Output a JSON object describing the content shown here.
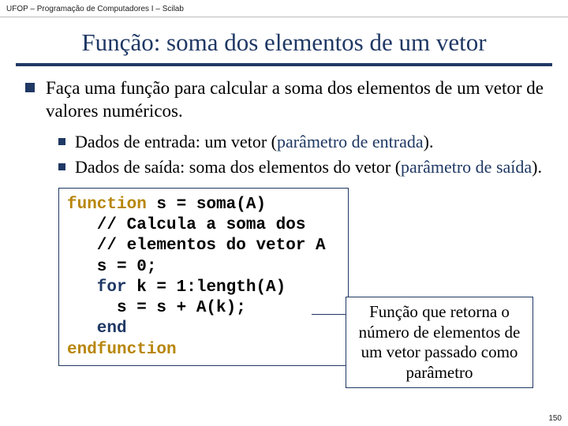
{
  "header": "UFOP – Programação de Computadores I – Scilab",
  "title": "Função: soma dos elementos de um vetor",
  "bullet1": "Faça uma função para calcular a soma dos elementos de um vetor de valores numéricos.",
  "sub1_pre": "Dados de entrada: um vetor (",
  "sub1_em": "parâmetro de entrada",
  "sub1_post": ").",
  "sub2_pre": "Dados de saída: soma dos elementos do vetor (",
  "sub2_em": "parâmetro de saída",
  "sub2_post": ").",
  "code": {
    "l1a": "function",
    "l1b": " s = soma(A)",
    "l2": "   // Calcula a soma dos",
    "l3": "   // elementos do vetor A",
    "l4": "   s = 0;",
    "l5a": "   for",
    "l5b": " k = 1:length(A)",
    "l6": "     s = s + A(k);",
    "l7": "   end",
    "l8": "endfunction"
  },
  "callout": "Função que retorna o número de elementos de um vetor passado como parâmetro",
  "pagenum": "150"
}
